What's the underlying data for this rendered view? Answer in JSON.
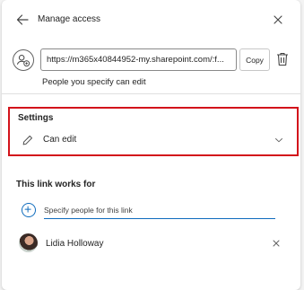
{
  "header": {
    "title": "Manage access",
    "back_icon": "arrow-left-icon",
    "close_icon": "close-icon"
  },
  "link": {
    "icon": "link-people-icon",
    "url": "https://m365x40844952-my.sharepoint.com/:f...",
    "copy_label": "Copy",
    "delete_icon": "trash-icon",
    "description": "People you specify can edit"
  },
  "settings": {
    "title": "Settings",
    "permission_icon": "pencil-icon",
    "permission_value": "Can edit",
    "dropdown_icon": "chevron-down-icon",
    "highlight_color": "#d3131b"
  },
  "works_for": {
    "title": "This link works for",
    "add_icon": "add-circle-icon",
    "placeholder": "Specify people for this link",
    "accent_color": "#0f6cbd",
    "people": [
      {
        "name": "Lidia Holloway",
        "remove_icon": "close-icon"
      }
    ]
  }
}
